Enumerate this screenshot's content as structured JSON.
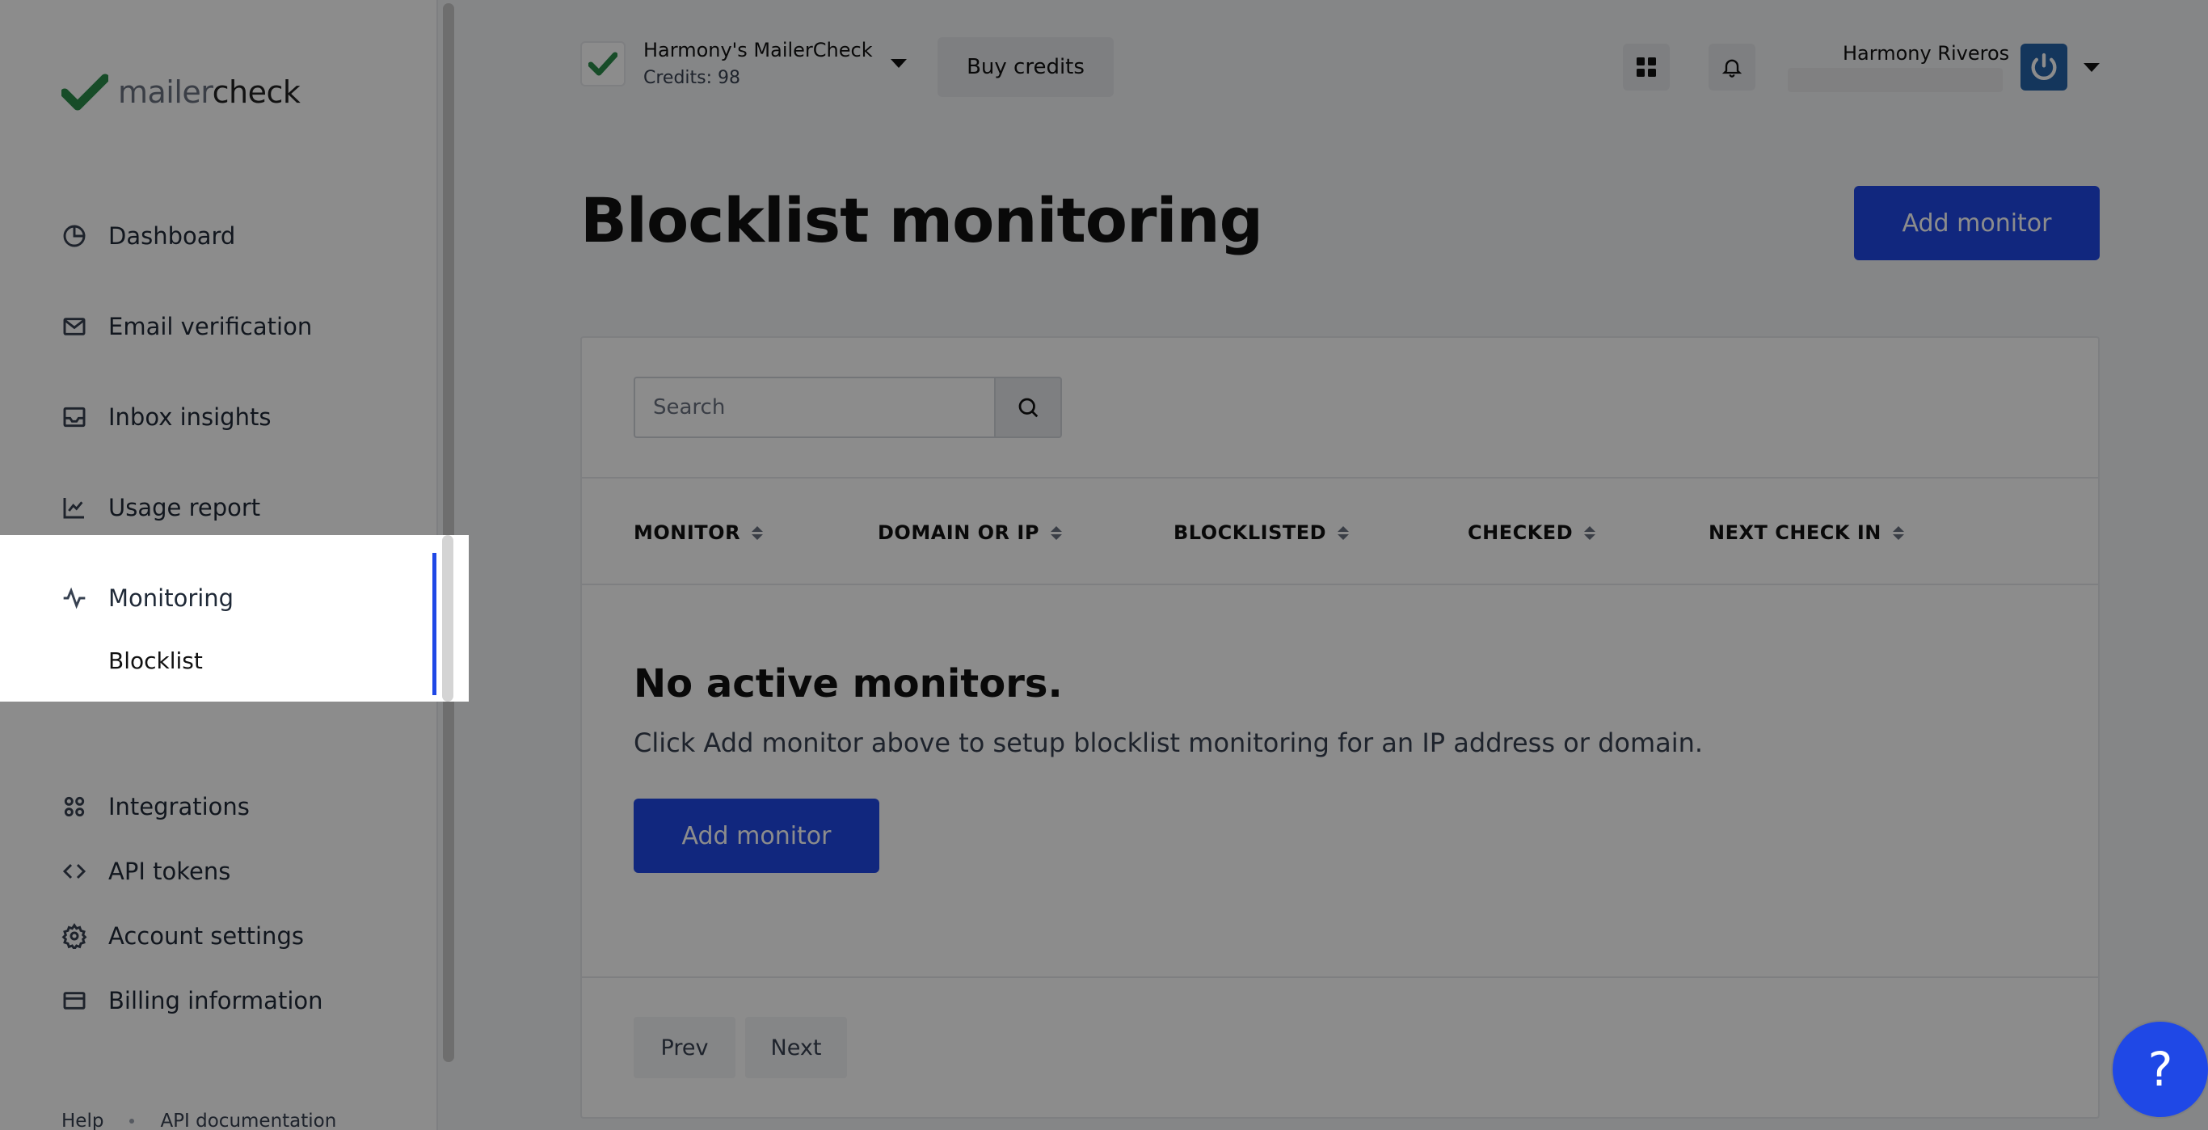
{
  "brand": {
    "logo_light": "mailer",
    "logo_bold": "check",
    "accent": "#1f48e6",
    "check_color": "#2a8a4a"
  },
  "sidebar": {
    "items": [
      {
        "label": "Dashboard",
        "icon": "pie-chart-icon"
      },
      {
        "label": "Email verification",
        "icon": "mail-check-icon"
      },
      {
        "label": "Inbox insights",
        "icon": "inbox-icon"
      },
      {
        "label": "Usage report",
        "icon": "line-chart-icon"
      },
      {
        "label": "Monitoring",
        "icon": "activity-icon"
      },
      {
        "label": "Integrations",
        "icon": "grid-circles-icon"
      },
      {
        "label": "API tokens",
        "icon": "code-icon"
      },
      {
        "label": "Account settings",
        "icon": "gear-icon"
      },
      {
        "label": "Billing information",
        "icon": "credit-card-icon"
      }
    ],
    "sub_item": "Blocklist",
    "footer": {
      "help": "Help",
      "api_docs": "API documentation"
    }
  },
  "topbar": {
    "account_name": "Harmony's MailerCheck",
    "credits": "Credits: 98",
    "buy_credits": "Buy credits",
    "user_name": "Harmony Riveros"
  },
  "page": {
    "title": "Blocklist monitoring",
    "add_monitor": "Add monitor"
  },
  "search": {
    "placeholder": "Search"
  },
  "table": {
    "columns": [
      "MONITOR",
      "DOMAIN OR IP",
      "BLOCKLISTED",
      "CHECKED",
      "NEXT CHECK IN"
    ]
  },
  "empty_state": {
    "title": "No active monitors.",
    "description": "Click Add monitor above to setup blocklist monitoring for an IP address or domain.",
    "button": "Add monitor"
  },
  "pagination": {
    "prev": "Prev",
    "next": "Next"
  },
  "help_button": "?"
}
